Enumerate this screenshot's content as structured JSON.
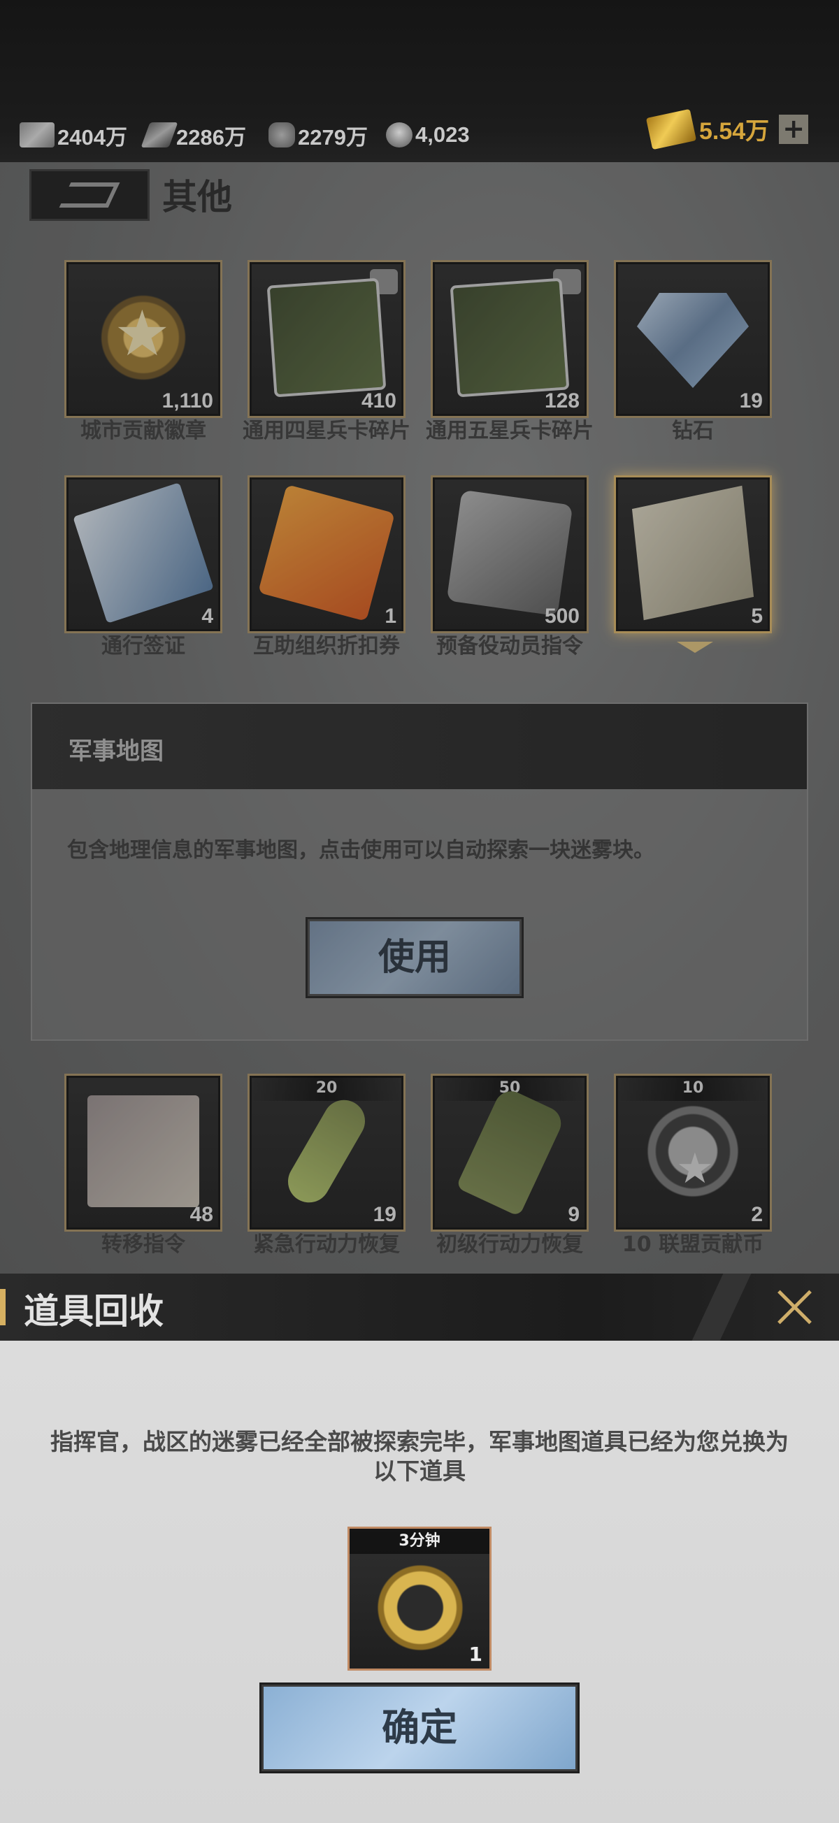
{
  "resources": [
    {
      "icon": "cash-icon",
      "value": "2404万"
    },
    {
      "icon": "steel-icon",
      "value": "2286万"
    },
    {
      "icon": "oil-icon",
      "value": "2279万"
    },
    {
      "icon": "helmet-icon",
      "value": "4,023"
    }
  ],
  "gold": {
    "icon": "gold-bar-icon",
    "value": "5.54万",
    "plus": "+"
  },
  "category": {
    "title": "其他"
  },
  "items": [
    {
      "name": "城市贡献徽章",
      "count": "1,110",
      "top_label": "",
      "icon": "medal-icon"
    },
    {
      "name": "通用四星兵卡碎片",
      "count": "410",
      "top_label": "",
      "icon": "puzzle-card-icon"
    },
    {
      "name": "通用五星兵卡碎片",
      "count": "128",
      "top_label": "",
      "icon": "puzzle-card-icon"
    },
    {
      "name": "钻石",
      "count": "19",
      "top_label": "",
      "icon": "diamond-icon"
    },
    {
      "name": "通行签证",
      "count": "4",
      "top_label": "",
      "icon": "pass-icon"
    },
    {
      "name": "互助组织折扣券",
      "count": "1",
      "top_label": "",
      "icon": "ticket-icon"
    },
    {
      "name": "预备役动员指令",
      "count": "500",
      "top_label": "",
      "icon": "reserve-order-icon"
    },
    {
      "name": "",
      "count": "5",
      "top_label": "",
      "icon": "map-icon"
    },
    {
      "name": "转移指令",
      "count": "48",
      "top_label": "",
      "icon": "transfer-icon"
    },
    {
      "name": "紧急行动力恢复",
      "count": "19",
      "top_label": "20",
      "icon": "vial-icon"
    },
    {
      "name": "初级行动力恢复",
      "count": "9",
      "top_label": "50",
      "icon": "bottle-icon"
    },
    {
      "name": "10 联盟贡献币",
      "count": "2",
      "top_label": "10",
      "icon": "alliance-coin-icon"
    }
  ],
  "detail": {
    "title": "军事地图",
    "description": "包含地理信息的军事地图，点击使用可以自动探索一块迷雾块。",
    "use_label": "使用"
  },
  "modal": {
    "title": "道具回收",
    "message": "指挥官，战区的迷雾已经全部被探索完毕，军事地图道具已经为您兑换为以下道具",
    "reward": {
      "top_label": "3分钟",
      "count": "1",
      "icon": "speedup-clock-icon"
    },
    "confirm_label": "确定"
  }
}
